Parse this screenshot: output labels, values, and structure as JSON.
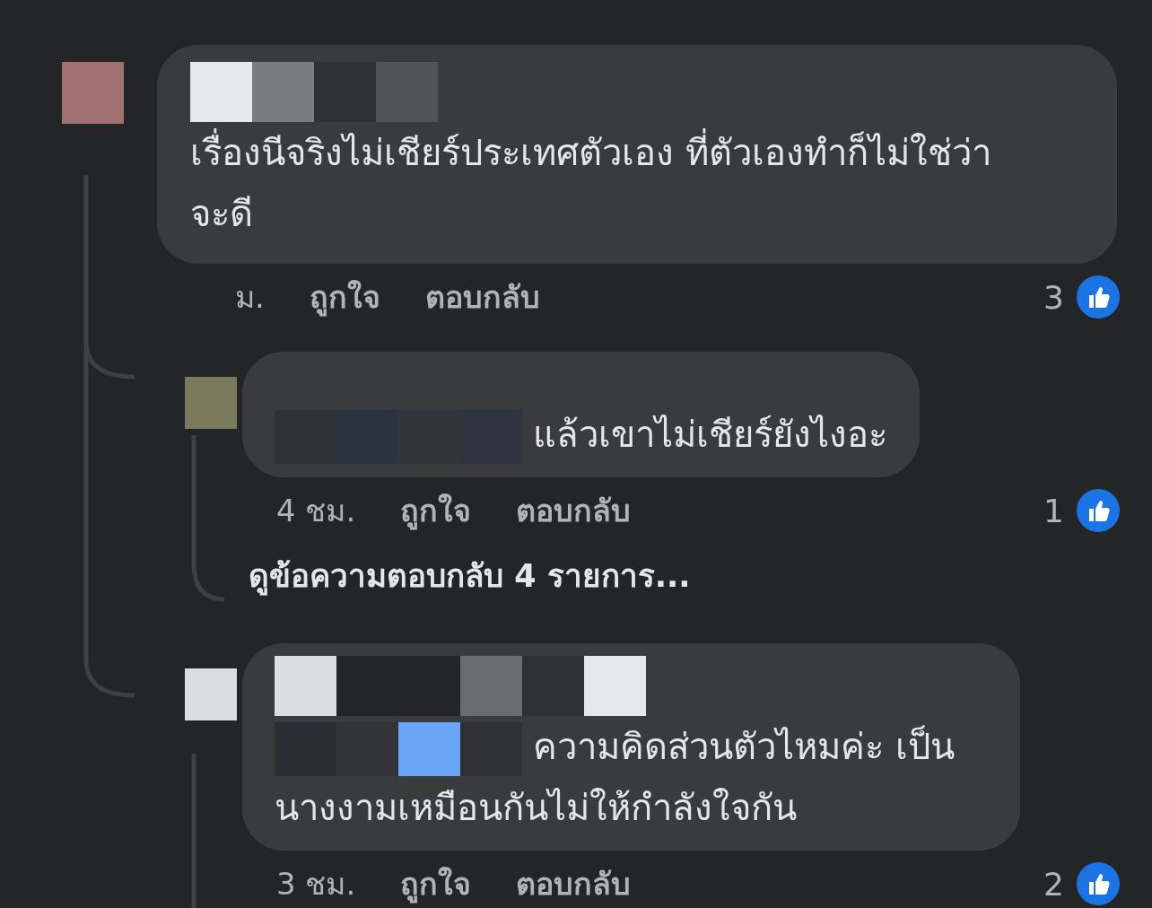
{
  "comment": {
    "text": "เรื่องนีจริงไม่เชียร์ประเทศตัวเอง ที่ตัวเองทำก็ไม่ใช่ว่าจะดี",
    "time": "ม.",
    "like": "ถูกใจ",
    "reply": "ตอบกลับ",
    "reactions": "3",
    "replies": [
      {
        "text": "แล้วเขาไม่เชียร์ยังไงอะ",
        "time": "4 ชม.",
        "like": "ถูกใจ",
        "reply": "ตอบกลับ",
        "reactions": "1",
        "more_replies": "ดูข้อความตอบกลับ 4 รายการ..."
      },
      {
        "text": "ความคิดส่วนตัวไหมค่ะ เป็นนางงามเหมือนกันไม่ให้กำลังใจกัน",
        "time": "3 ชม.",
        "like": "ถูกใจ",
        "reply": "ตอบกลับ",
        "reactions": "2"
      }
    ]
  }
}
